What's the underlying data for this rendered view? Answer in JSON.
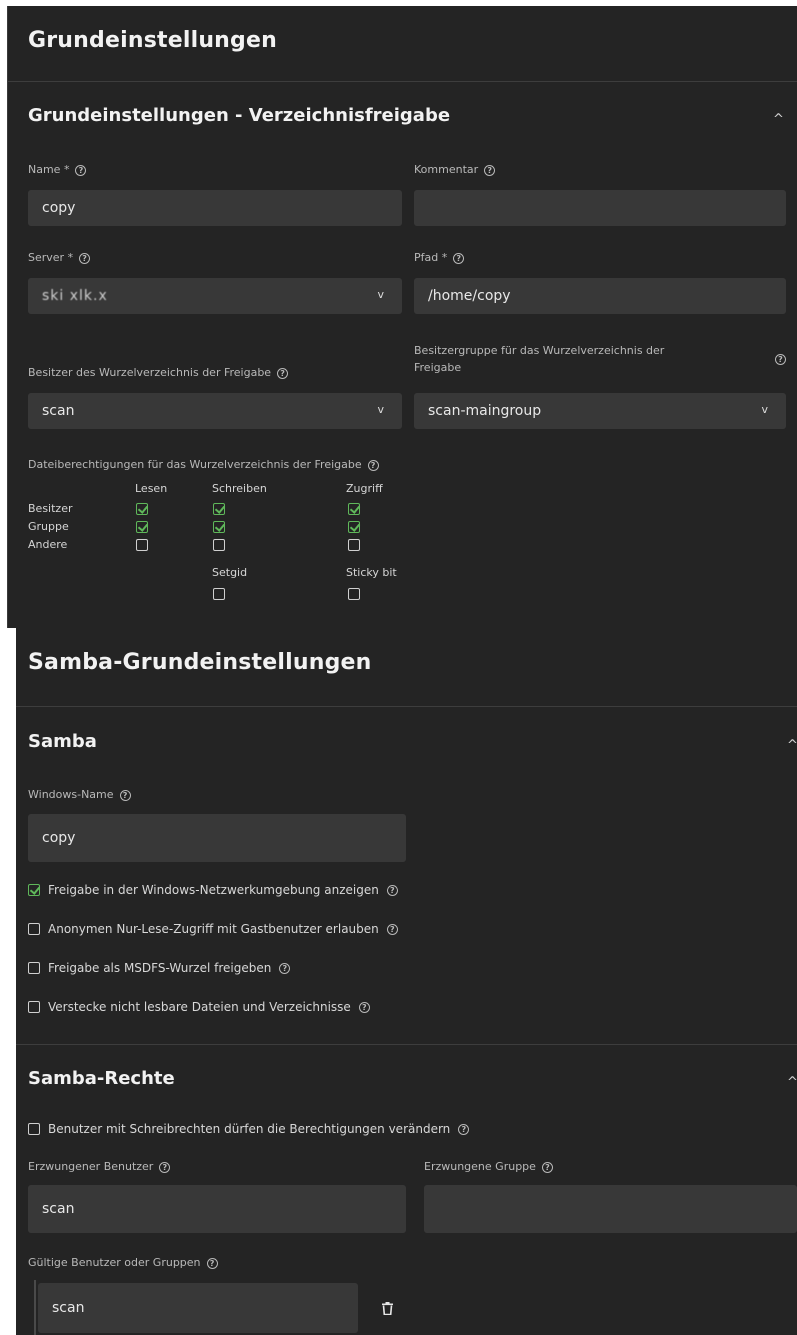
{
  "section1": {
    "page_title": "Grundeinstellungen",
    "card_title": "Grundeinstellungen - Verzeichnisfreigabe",
    "name": {
      "label": "Name *",
      "value": "copy"
    },
    "comment": {
      "label": "Kommentar",
      "value": ""
    },
    "server": {
      "label": "Server *",
      "value": "ski xlk.x"
    },
    "path": {
      "label": "Pfad *",
      "value": "/home/copy"
    },
    "owner": {
      "label": "Besitzer des Wurzelverzeichnis der Freigabe",
      "value": "scan"
    },
    "owner_group": {
      "label_line1": "Besitzergruppe für das Wurzelverzeichnis der",
      "label_line2": "Freigabe",
      "value": "scan-maingroup"
    },
    "perm_label": "Dateiberechtigungen für das Wurzelverzeichnis der Freigabe",
    "perm_cols": [
      "Lesen",
      "Schreiben",
      "Zugriff"
    ],
    "perm_rows": [
      {
        "name": "Besitzer",
        "checks": [
          true,
          true,
          true
        ]
      },
      {
        "name": "Gruppe",
        "checks": [
          true,
          true,
          true
        ]
      },
      {
        "name": "Andere",
        "checks": [
          false,
          false,
          false
        ]
      }
    ],
    "special": [
      {
        "label": "Setgid",
        "checked": false
      },
      {
        "label": "Sticky bit",
        "checked": false
      }
    ]
  },
  "section2": {
    "page_title": "Samba-Grundeinstellungen",
    "card_title": "Samba",
    "windows_name": {
      "label": "Windows-Name",
      "value": "copy"
    },
    "options": [
      {
        "label": "Freigabe in der Windows-Netzwerkumgebung anzeigen",
        "checked": true
      },
      {
        "label": "Anonymen Nur-Lese-Zugriff mit Gastbenutzer erlauben",
        "checked": false
      },
      {
        "label": "Freigabe als MSDFS-Wurzel freigeben",
        "checked": false
      },
      {
        "label": "Verstecke nicht lesbare Dateien und Verzeichnisse",
        "checked": false
      }
    ]
  },
  "section3": {
    "card_title": "Samba-Rechte",
    "option": {
      "label": "Benutzer mit Schreibrechten dürfen die Berechtigungen verändern",
      "checked": false
    },
    "forced_user": {
      "label": "Erzwungener Benutzer",
      "value": "scan"
    },
    "forced_group": {
      "label": "Erzwungene Gruppe",
      "value": ""
    },
    "valid_users": {
      "label": "Gültige Benutzer oder Gruppen",
      "value": "scan"
    }
  },
  "icons": {
    "help": "?",
    "chevron_up": "^",
    "chevron_down": "v",
    "trash": "trash-icon"
  },
  "colors": {
    "background": "#242424",
    "field": "#383838",
    "check_green": "#5fb85a"
  }
}
